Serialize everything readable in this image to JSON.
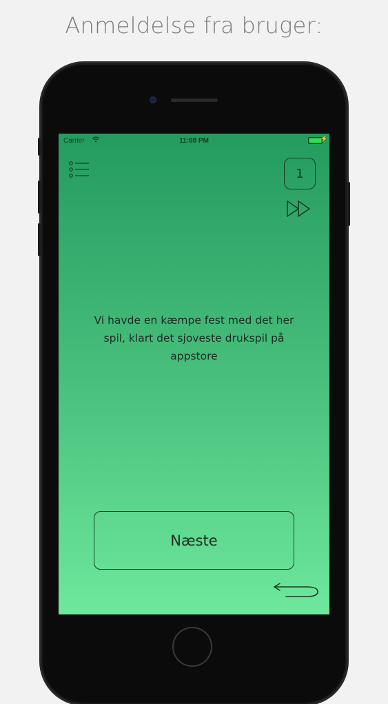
{
  "headline": "Anmeldelse fra bruger:",
  "status_bar": {
    "carrier": "Carrier",
    "time": "11:08 PM"
  },
  "counter": "1",
  "review_text": "Vi havde en kæmpe fest med det her spil, klart det sjoveste drukspil på appstore",
  "next_button_label": "Næste",
  "colors": {
    "gradient_top": "#249b5f",
    "gradient_bottom": "#6de89c",
    "ink": "#1a3a25",
    "page_background": "#f3f2f3"
  },
  "icons": [
    "menu-icon",
    "fast-forward-icon",
    "back-arrow-icon",
    "wifi-icon",
    "battery-icon"
  ]
}
